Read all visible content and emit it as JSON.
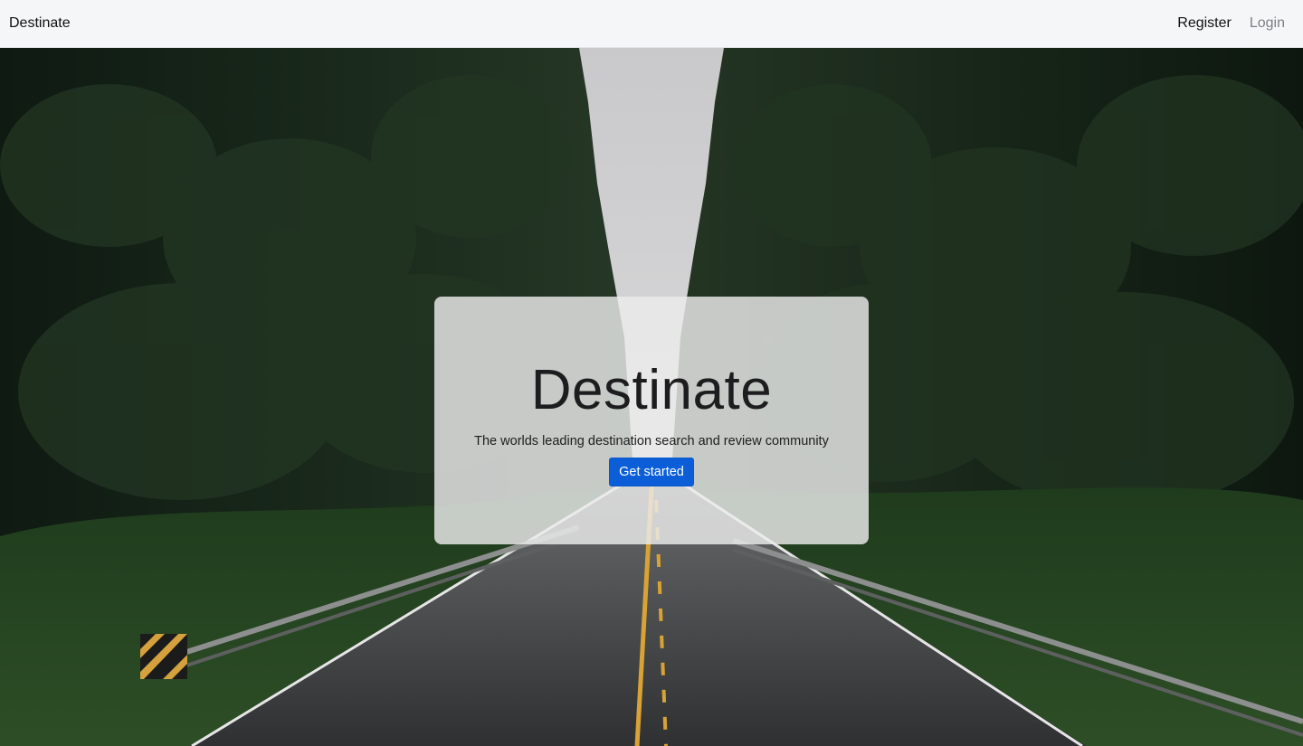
{
  "navbar": {
    "brand": "Destinate",
    "links": {
      "register": "Register",
      "login": "Login"
    }
  },
  "hero": {
    "background_image": "forest-road-photo",
    "title": "Destinate",
    "subtitle": "The worlds leading destination search and review community",
    "cta_label": "Get started"
  },
  "colors": {
    "navbar_bg": "#f5f6f8",
    "cta_bg": "#0b5ed7",
    "login_link": "#7d7f82"
  }
}
